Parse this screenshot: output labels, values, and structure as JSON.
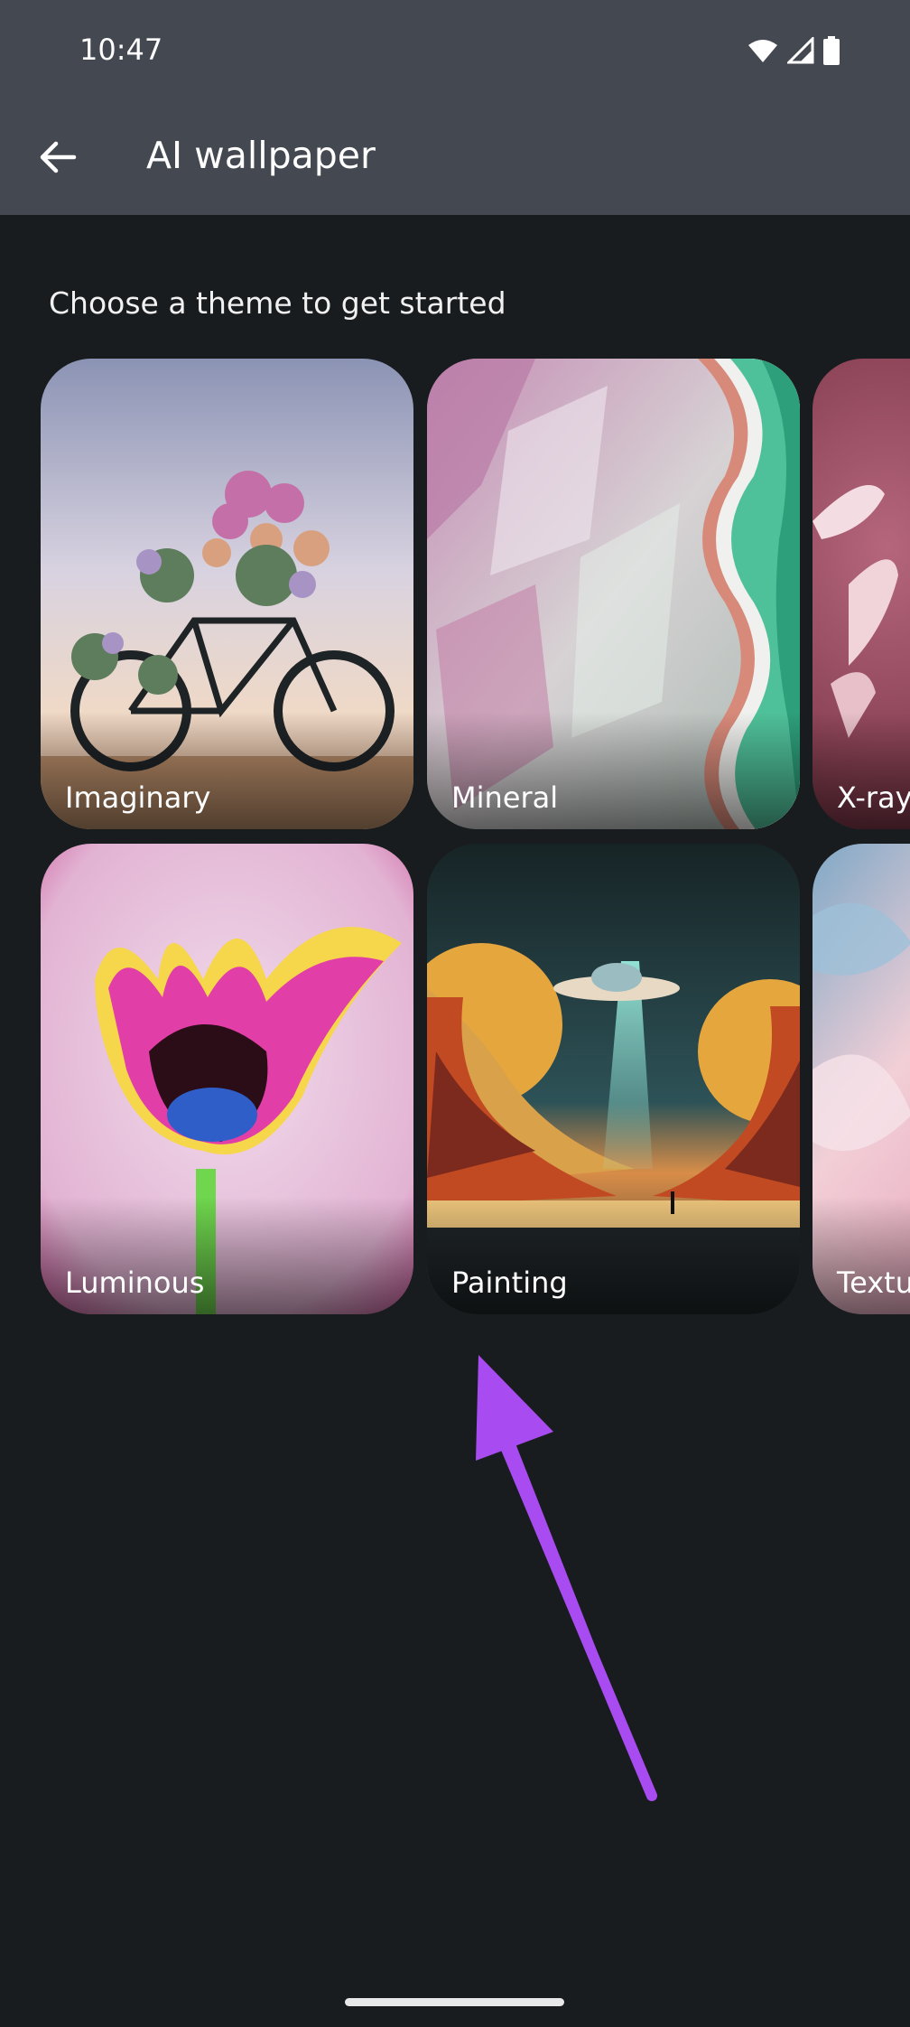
{
  "status_bar": {
    "time": "10:47",
    "icons": [
      "wifi-icon",
      "cellular-signal-icon",
      "battery-icon"
    ]
  },
  "app_bar": {
    "back_icon": "arrow-back-icon",
    "title": "AI wallpaper"
  },
  "main": {
    "heading": "Choose a theme to get started",
    "themes": [
      {
        "label": "Imaginary"
      },
      {
        "label": "Mineral"
      },
      {
        "label": "X-ray"
      },
      {
        "label": "Luminous"
      },
      {
        "label": "Painting"
      },
      {
        "label": "Texture"
      }
    ]
  },
  "annotation": {
    "arrow_color": "#a84cf2"
  },
  "colors": {
    "app_bar": "#444850",
    "background": "#191c1e"
  }
}
